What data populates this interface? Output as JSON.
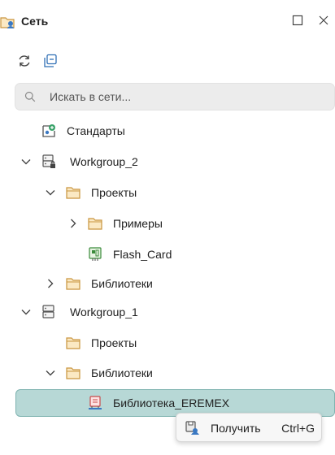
{
  "panel": {
    "title": "Сеть",
    "title_icon": "network-folder-icon"
  },
  "window_controls": {
    "maximize_icon": "maximize-icon",
    "close_icon": "close-icon",
    "close_glyph": "×"
  },
  "toolbar": {
    "refresh_icon": "refresh-icon",
    "collapse_icon": "collapse-all-icon"
  },
  "search": {
    "placeholder": "Искать в сети...",
    "value": "",
    "icon": "search-icon"
  },
  "tree": {
    "items": [
      {
        "label": "Стандарты",
        "icon": "standards-icon"
      },
      {
        "label": "Workgroup_2",
        "icon": "server-lock-icon",
        "expanded": true
      },
      {
        "label": "Проекты",
        "icon": "folder-icon",
        "expanded": true
      },
      {
        "label": "Примеры",
        "icon": "folder-icon",
        "expanded": false
      },
      {
        "label": "Flash_Card",
        "icon": "project-board-icon"
      },
      {
        "label": "Библиотеки",
        "icon": "folder-icon",
        "expanded": false
      },
      {
        "label": "Workgroup_1",
        "icon": "server-icon",
        "expanded": true
      },
      {
        "label": "Проекты",
        "icon": "folder-icon"
      },
      {
        "label": "Библиотеки",
        "icon": "folder-icon",
        "expanded": true
      },
      {
        "label": "Библиотека_EREMEX",
        "icon": "library-icon",
        "selected": true
      }
    ]
  },
  "context_menu": {
    "items": [
      {
        "label": "Получить",
        "shortcut": "Ctrl+G",
        "icon": "download-save-icon"
      }
    ]
  },
  "colors": {
    "selection_bg": "#b7d8d6",
    "selection_border": "#7fb3b0",
    "folder_fill": "#fbe9c4",
    "folder_stroke": "#c9953e",
    "accent_blue": "#3a78c2"
  }
}
